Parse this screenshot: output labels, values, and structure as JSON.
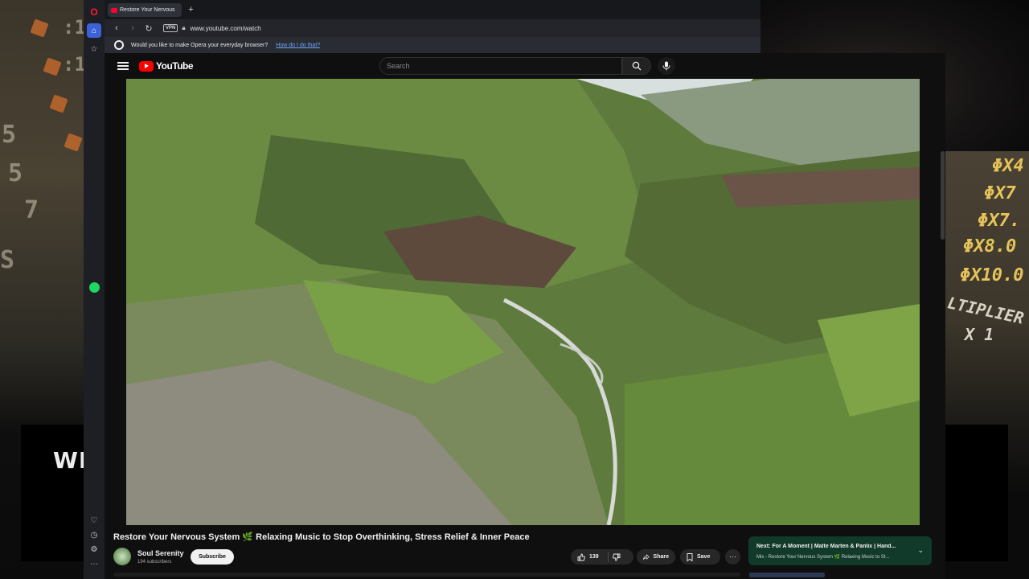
{
  "browser": {
    "tab": {
      "title": "Restore Your Nervous"
    },
    "address": {
      "url": "www.youtube.com/watch",
      "vpn_label": "VPN"
    },
    "infobar": {
      "message": "Would you like to make Opera your everyday browser?",
      "link": "How do I do that?"
    }
  },
  "youtube": {
    "logo_text": "YouTube",
    "search": {
      "placeholder": "Search"
    },
    "video": {
      "title": "Restore Your Nervous System 🌿 Relaxing Music to Stop Overthinking, Stress Relief & Inner Peace",
      "channel": {
        "name": "Soul Serenity",
        "subscribers": "194 subscribers",
        "subscribe_label": "Subscribe"
      },
      "actions": {
        "likes": "139",
        "share_label": "Share",
        "save_label": "Save"
      }
    },
    "next": {
      "title": "Next: For A Moment | Malte Marten & Panlix | Hand...",
      "subtitle": "Mix - Restore Your Nervous System 🌿 Relaxing Music to St..."
    }
  },
  "stream_overlay": {
    "welcome_text": "WE",
    "multipliers": [
      "ΦX4",
      "ΦX7",
      "ΦX7.",
      "ΦX8.0",
      "ΦX10.0"
    ],
    "multiplier_label": "LTIPLIER",
    "multiplier_value": "X 1",
    "left_digits": [
      "5",
      "5",
      "7",
      "S",
      ":1",
      ":1"
    ]
  },
  "colors": {
    "yt_red": "#ff0000",
    "opera_red": "#ff1b2d",
    "next_card_bg": "#123a2a",
    "link_blue": "#6fa5ff"
  }
}
